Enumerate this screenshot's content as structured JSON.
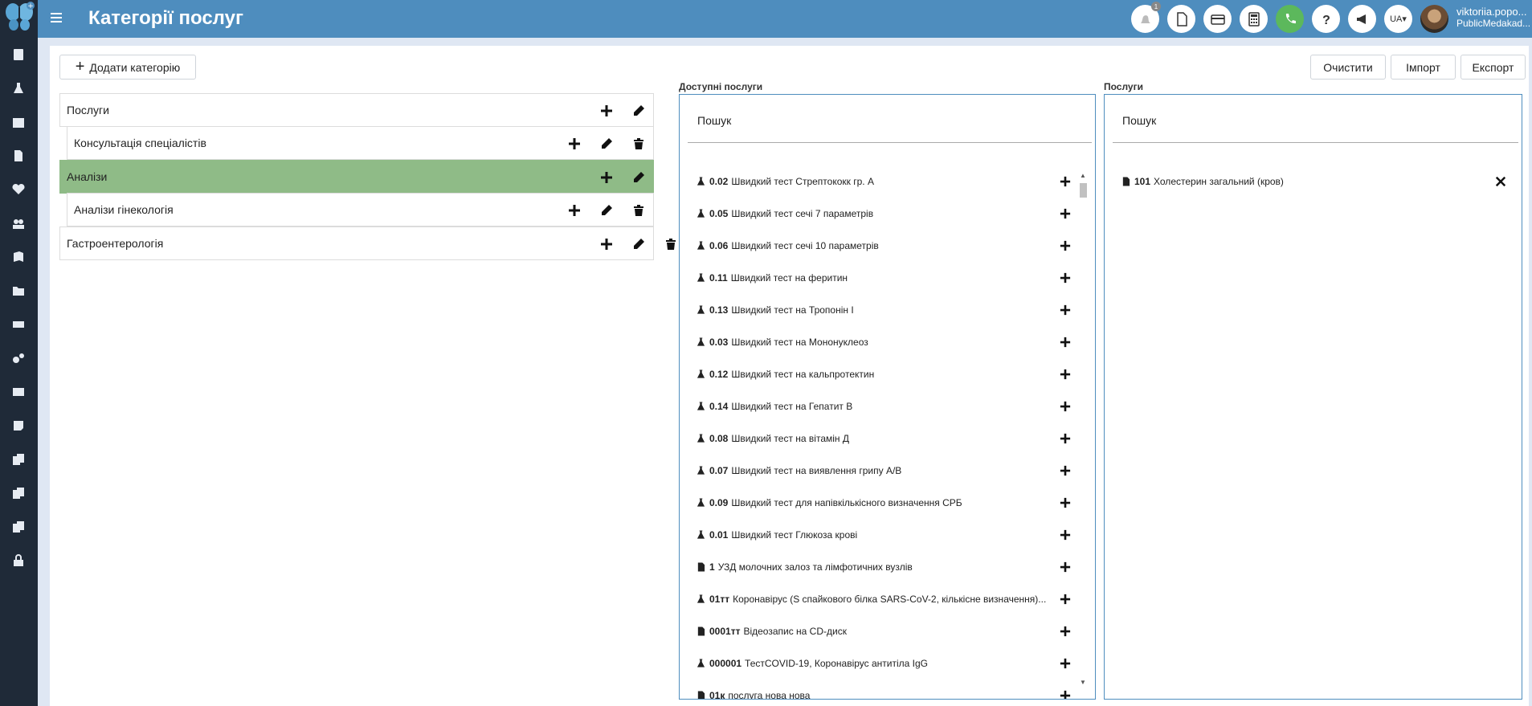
{
  "header": {
    "title": "Категорії послуг",
    "lang": "UA",
    "user_name": "viktoriia.popo...",
    "user_org": "PublicMedakad...",
    "notification_count": "1"
  },
  "toolbar": {
    "add_category": "Додати категорію",
    "clear": "Очистити",
    "import": "Імпорт",
    "export": "Експорт"
  },
  "categories": [
    {
      "label": "Послуги",
      "level": 0,
      "active": false
    },
    {
      "label": "Консультація спеціалістів",
      "level": 1,
      "active": false
    },
    {
      "label": "Аналізи",
      "level": 0,
      "active": true
    },
    {
      "label": "Аналізи гінекологія",
      "level": 1,
      "active": false
    },
    {
      "label": "Гастроентерологія",
      "level": 0,
      "active": false
    }
  ],
  "available": {
    "title": "Доступні послуги",
    "search_placeholder": "Пошук",
    "items": [
      {
        "code": "0.02",
        "name": "Швидкий тест Стрептококк гр. А",
        "icon": "flask-icon"
      },
      {
        "code": "0.05",
        "name": "Швидкий тест сечі 7 параметрів",
        "icon": "flask-icon"
      },
      {
        "code": "0.06",
        "name": "Швидкий тест сечі 10 параметрів",
        "icon": "flask-icon"
      },
      {
        "code": "0.11",
        "name": "Швидкий тест на феритин",
        "icon": "flask-icon"
      },
      {
        "code": "0.13",
        "name": "Швидкий тест на Тропонін I",
        "icon": "flask-icon"
      },
      {
        "code": "0.03",
        "name": "Швидкий тест на Мононуклеоз",
        "icon": "flask-icon"
      },
      {
        "code": "0.12",
        "name": "Швидкий тест на кальпротектин",
        "icon": "flask-icon"
      },
      {
        "code": "0.14",
        "name": "Швидкий тест на Гепатит В",
        "icon": "flask-icon"
      },
      {
        "code": "0.08",
        "name": "Швидкий тест на вітамін Д",
        "icon": "flask-icon"
      },
      {
        "code": "0.07",
        "name": "Швидкий тест на виявлення грипу А/В",
        "icon": "flask-icon"
      },
      {
        "code": "0.09",
        "name": "Швидкий тест для напівкількісного визначення СРБ",
        "icon": "flask-icon"
      },
      {
        "code": "0.01",
        "name": "Швидкий тест Глюкоза крові",
        "icon": "flask-icon"
      },
      {
        "code": "1",
        "name": "УЗД молочних залоз та лімфотичних вузлів",
        "icon": "document-icon"
      },
      {
        "code": "01тт",
        "name": "Коронавірус (S спайкового білка SARS-CoV-2, кількісне визначення)...",
        "icon": "flask-icon"
      },
      {
        "code": "0001тт",
        "name": "Відеозапис на CD-диск",
        "icon": "document-icon"
      },
      {
        "code": "000001",
        "name": "ТестCOVID-19, Коронавірус антитіла IgG",
        "icon": "flask-icon"
      },
      {
        "code": "01к",
        "name": "послуга нова нова",
        "icon": "document-icon"
      }
    ]
  },
  "selected": {
    "title": "Послуги",
    "search_placeholder": "Пошук",
    "items": [
      {
        "code": "101",
        "name": "Холестерин загальний (кров)",
        "icon": "document-icon"
      }
    ]
  }
}
